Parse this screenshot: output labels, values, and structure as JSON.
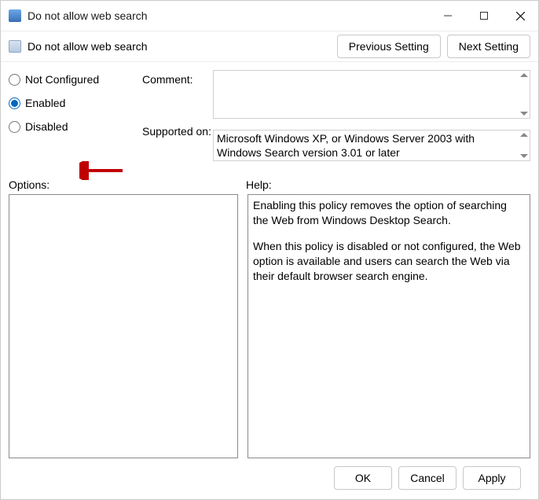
{
  "window": {
    "title": "Do not allow web search"
  },
  "header": {
    "title": "Do not allow web search",
    "previous_btn": "Previous Setting",
    "next_btn": "Next Setting"
  },
  "radios": {
    "not_configured": "Not Configured",
    "enabled": "Enabled",
    "disabled": "Disabled",
    "selected": "enabled"
  },
  "labels": {
    "comment": "Comment:",
    "supported": "Supported on:",
    "options": "Options:",
    "help": "Help:"
  },
  "supported_on": "Microsoft Windows XP, or Windows Server 2003 with Windows Search version 3.01 or later",
  "help": {
    "p1": "Enabling this policy removes the option of searching the Web from Windows Desktop Search.",
    "p2": "When this policy is disabled or not configured, the Web option is available and users can search the Web via their default browser search engine."
  },
  "footer": {
    "ok": "OK",
    "cancel": "Cancel",
    "apply": "Apply"
  },
  "colors": {
    "accent": "#0067c0",
    "arrow": "#c00000"
  }
}
